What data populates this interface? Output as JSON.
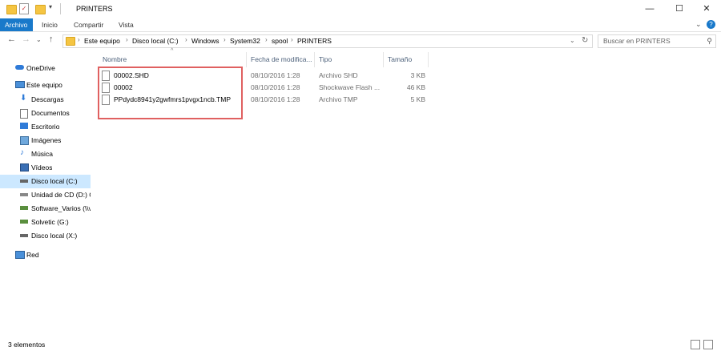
{
  "window": {
    "title": "PRINTERS"
  },
  "ribbon": {
    "tabs": [
      "Archivo",
      "Inicio",
      "Compartir",
      "Vista"
    ]
  },
  "address": {
    "crumbs": [
      "Este equipo",
      "Disco local (C:)",
      "Windows",
      "System32",
      "spool",
      "PRINTERS"
    ]
  },
  "search": {
    "placeholder": "Buscar en PRINTERS"
  },
  "sidebar": {
    "items": [
      {
        "label": "OneDrive",
        "icon": "cloud-icon"
      },
      {
        "label": "Este equipo",
        "icon": "computer-icon"
      },
      {
        "label": "Descargas",
        "icon": "downloads-icon"
      },
      {
        "label": "Documentos",
        "icon": "documents-icon"
      },
      {
        "label": "Escritorio",
        "icon": "desktop-icon"
      },
      {
        "label": "Imágenes",
        "icon": "pictures-icon"
      },
      {
        "label": "Música",
        "icon": "music-icon"
      },
      {
        "label": "Vídeos",
        "icon": "videos-icon"
      },
      {
        "label": "Disco local (C:)",
        "icon": "drive-icon",
        "selected": true
      },
      {
        "label": "Unidad de CD (D:) C",
        "icon": "cd-drive-icon"
      },
      {
        "label": "Software_Varios (\\\\v",
        "icon": "network-drive-icon"
      },
      {
        "label": "Solvetic (G:)",
        "icon": "network-drive-icon"
      },
      {
        "label": "Disco local (X:)",
        "icon": "drive-icon"
      },
      {
        "label": "Red",
        "icon": "network-icon"
      }
    ]
  },
  "columns": {
    "name": "Nombre",
    "date": "Fecha de modifica...",
    "type": "Tipo",
    "size": "Tamaño"
  },
  "files": [
    {
      "name": "00002.SHD",
      "date": "08/10/2016 1:28",
      "type": "Archivo SHD",
      "size": "3 KB"
    },
    {
      "name": "00002",
      "date": "08/10/2016 1:28",
      "type": "Shockwave Flash ...",
      "size": "46 KB"
    },
    {
      "name": "PPdydc8941y2gwfmrs1pvgx1ncb.TMP",
      "date": "08/10/2016 1:28",
      "type": "Archivo TMP",
      "size": "5 KB"
    }
  ],
  "status": {
    "count": "3 elementos"
  },
  "colors": {
    "accent": "#1979ca",
    "selected": "#cce8ff",
    "highlight_box": "#e06060"
  }
}
